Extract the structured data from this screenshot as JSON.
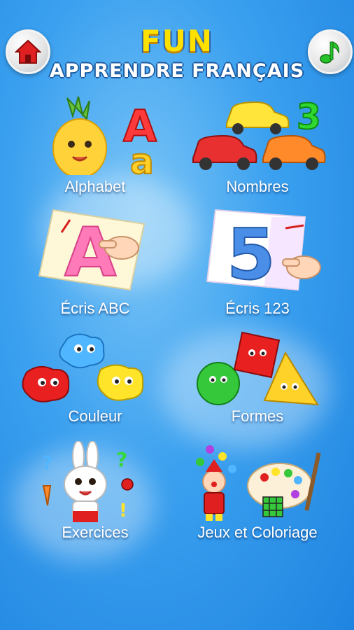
{
  "header": {
    "title": "FUN",
    "subtitle": "APPRENDRE FRANÇAIS",
    "home_icon": "home-icon",
    "music_icon": "music-note-icon"
  },
  "menu": [
    {
      "label": "Alphabet"
    },
    {
      "label": "Nombres"
    },
    {
      "label": "Écris ABC"
    },
    {
      "label": "Écris 123"
    },
    {
      "label": "Couleur"
    },
    {
      "label": "Formes"
    },
    {
      "label": "Exercices"
    },
    {
      "label": "Jeux et Coloriage"
    }
  ],
  "art_text": {
    "letter_big": "A",
    "letter_small": "a",
    "number_3": "3",
    "trace_letter": "A",
    "trace_number": "5",
    "question": "?",
    "exclaim": "!"
  },
  "colors": {
    "background": "#2f95eb",
    "title_yellow": "#ffe100",
    "home_red": "#e02020",
    "music_green": "#26c22a"
  }
}
